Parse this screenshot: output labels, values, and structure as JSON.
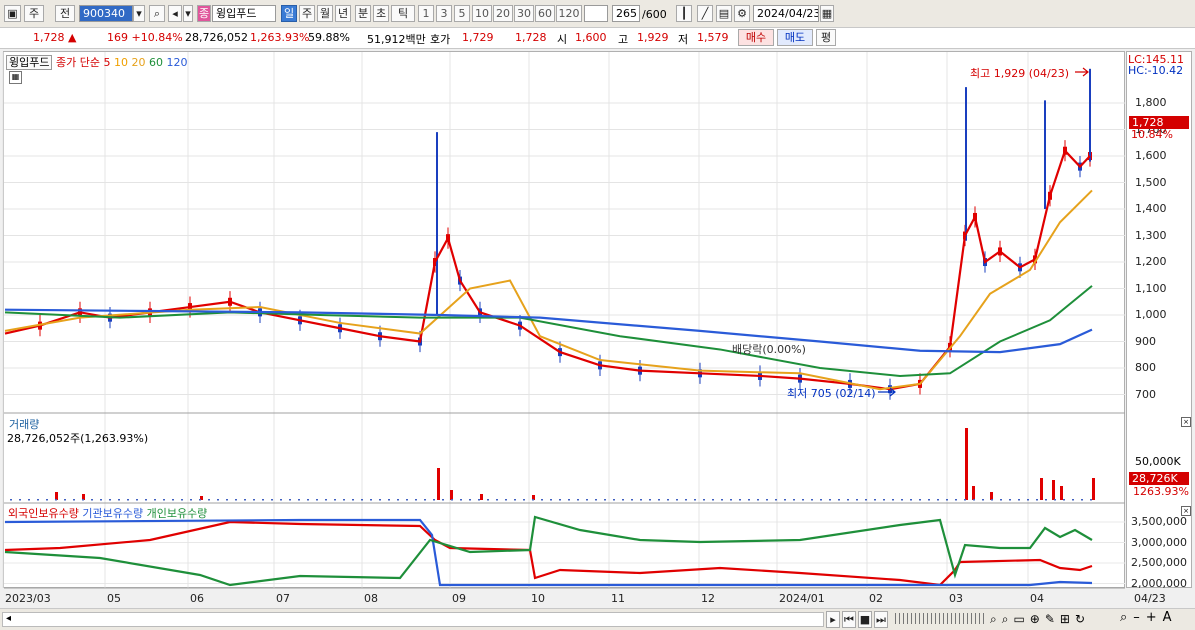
{
  "toolbar": {
    "mode_label": "주",
    "prev_label": "전",
    "code_value": "900340",
    "name_badge": "종",
    "stock_name": "윙입푸드",
    "periods": [
      "일",
      "주",
      "월",
      "년",
      "분",
      "초",
      "틱"
    ],
    "active_period": "일",
    "numbers": [
      "1",
      "3",
      "5",
      "10",
      "20",
      "30",
      "60",
      "120"
    ],
    "count_value": "265",
    "count_total": "/600",
    "date_value": "2024/04/23"
  },
  "quote": {
    "price": "1,728",
    "change": "169 +10.84%",
    "volume": "28,726,052",
    "vol_pct": "1,263.93%",
    "turnover": "59.88%",
    "amount": "51,912백만",
    "ask_label": "호가",
    "ask1": "1,729",
    "ask2": "1,728",
    "open_label": "시",
    "open": "1,600",
    "high_label": "고",
    "high": "1,929",
    "low_label": "저",
    "low": "1,579",
    "buy_label": "매수",
    "sell_label": "매도",
    "eval_label": "평"
  },
  "legend": {
    "name": "윙입푸드",
    "ma_label": "종가 단순",
    "ma5": "5",
    "ma10": "10",
    "ma20": "20",
    "ma60": "60",
    "ma120": "120"
  },
  "annotations": {
    "high": "최고 1,929 (04/23)",
    "low": "최저 705 (02/14)",
    "dividend": "배당락(0.00%)",
    "lc": "LC:145.11",
    "hc": "HC:-10.42"
  },
  "price_axis": {
    "ticks": [
      "1,800",
      "1,700",
      "1,600",
      "1,500",
      "1,400",
      "1,300",
      "1,200",
      "1,100",
      "1,000",
      "900",
      "800",
      "700"
    ],
    "current": "1,728",
    "current_pct": "10.84%"
  },
  "volume_panel": {
    "title": "거래량",
    "info": "28,726,052주(1,263.93%)",
    "tick": "50,000K",
    "current": "28,726K",
    "current_pct": "1263.93%"
  },
  "holdings_panel": {
    "foreign": "외국인보유수량",
    "inst": "기관보유수량",
    "indiv": "개인보유수량",
    "ticks": [
      "3,500,000",
      "3,000,000",
      "2,500,000",
      "2,000,000"
    ]
  },
  "x_axis": [
    "2023/03",
    "05",
    "06",
    "07",
    "08",
    "09",
    "10",
    "11",
    "12",
    "2024/01",
    "02",
    "03",
    "04"
  ],
  "x_axis_end": "04/23",
  "colors": {
    "candle_up": "#e00000",
    "candle_down": "#1a3fbf",
    "ma5": "#e00000",
    "ma10": "#f0a000",
    "ma20": "#e6a21c",
    "ma60": "#1e8f3a",
    "ma120": "#2a5bd8"
  }
}
